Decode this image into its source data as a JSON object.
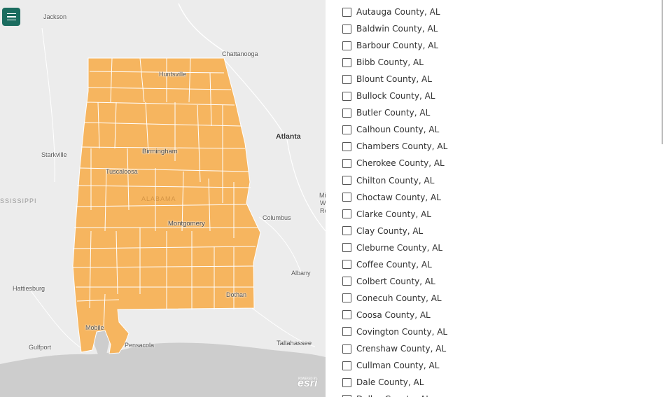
{
  "map": {
    "state_fill": "#f6b55f",
    "state_stroke": "#ffffff",
    "water": "#cdcdcd",
    "land": "#ececec",
    "cities": [
      {
        "name": "Jackson",
        "style": "small"
      },
      {
        "name": "Chattanooga",
        "style": "small"
      },
      {
        "name": "Huntsville",
        "style": "small"
      },
      {
        "name": "Atlanta",
        "style": "big"
      },
      {
        "name": "Starkville",
        "style": "small"
      },
      {
        "name": "Birmingham",
        "style": "med"
      },
      {
        "name": "Tuscaloosa",
        "style": "small"
      },
      {
        "name": "ALABAMA",
        "style": "state"
      },
      {
        "name": "SSISSIPPI",
        "style": "state"
      },
      {
        "name": "Columbus",
        "style": "small"
      },
      {
        "name": "Montgomery",
        "style": "med"
      },
      {
        "name": "Albany",
        "style": "small"
      },
      {
        "name": "Hattiesburg",
        "style": "small"
      },
      {
        "name": "Dothan",
        "style": "small"
      },
      {
        "name": "Mobile",
        "style": "small"
      },
      {
        "name": "Pensacola",
        "style": "small"
      },
      {
        "name": "Tallahassee",
        "style": "med"
      },
      {
        "name": "Gulfport",
        "style": "small"
      },
      {
        "name": "Mi",
        "style": "small"
      },
      {
        "name": "Ro",
        "style": "small"
      },
      {
        "name": "Wa",
        "style": "small"
      }
    ],
    "attribution_logo": "esri",
    "attribution_sub": "POWERED BY"
  },
  "menu_button": {
    "icon": "hamburger-icon"
  },
  "county_list": {
    "items": [
      "Autauga County, AL",
      "Baldwin County, AL",
      "Barbour County, AL",
      "Bibb County, AL",
      "Blount County, AL",
      "Bullock County, AL",
      "Butler County, AL",
      "Calhoun County, AL",
      "Chambers County, AL",
      "Cherokee County, AL",
      "Chilton County, AL",
      "Choctaw County, AL",
      "Clarke County, AL",
      "Clay County, AL",
      "Cleburne County, AL",
      "Coffee County, AL",
      "Colbert County, AL",
      "Conecuh County, AL",
      "Coosa County, AL",
      "Covington County, AL",
      "Crenshaw County, AL",
      "Cullman County, AL",
      "Dale County, AL",
      "Dallas County, AL"
    ]
  }
}
